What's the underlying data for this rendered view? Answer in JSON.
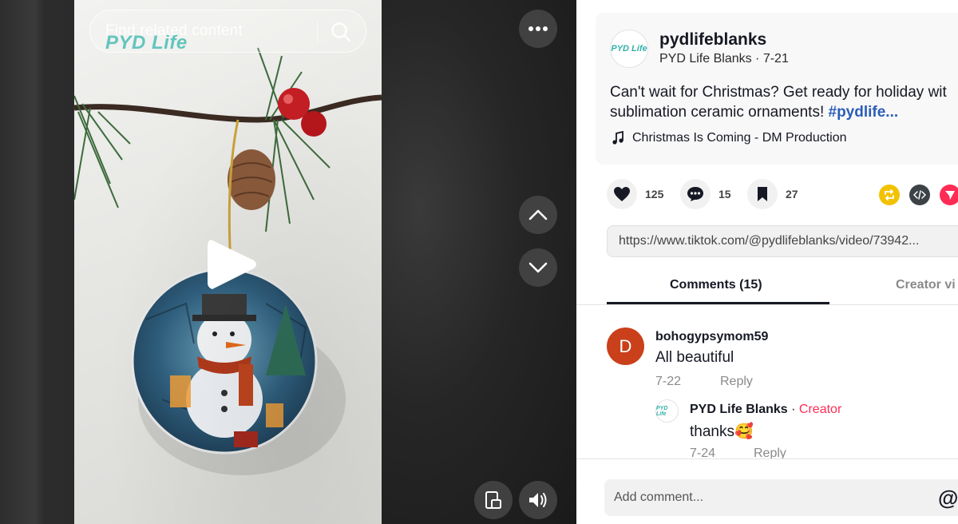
{
  "video": {
    "search_placeholder": "Find related content",
    "watermark": "PYD Life"
  },
  "post": {
    "avatar_text": "PYD Life",
    "author_handle": "pydlifeblanks",
    "author_name": "PYD Life Blanks",
    "separator": " · ",
    "date": "7-21",
    "description_line1": "Can't wait for Christmas? Get ready for holiday wit",
    "description_line2": "sublimation ceramic ornaments! ",
    "hashtag": "#pydlife...",
    "music": "Christmas Is Coming - DM Production"
  },
  "stats": {
    "likes": "125",
    "comments": "15",
    "saves": "27"
  },
  "share": {
    "repost_color": "#f2c200",
    "embed_color": "#3d4247",
    "send_color": "#fe2c55"
  },
  "link": "https://www.tiktok.com/@pydlifeblanks/video/73942...",
  "tabs": {
    "comments": "Comments (15)",
    "creator": "Creator vi"
  },
  "comments": [
    {
      "avatar_letter": "D",
      "user": "bohogypsymom59",
      "text": "All beautiful",
      "date": "7-22",
      "reply_label": "Reply",
      "replies": [
        {
          "avatar_text": "PYD Life",
          "user": "PYD Life Blanks",
          "separator": " · ",
          "badge": "Creator",
          "text": "thanks🥰",
          "date": "7-24",
          "reply_label": "Reply"
        }
      ]
    }
  ],
  "composer": {
    "placeholder": "Add comment...",
    "mention": "@"
  }
}
